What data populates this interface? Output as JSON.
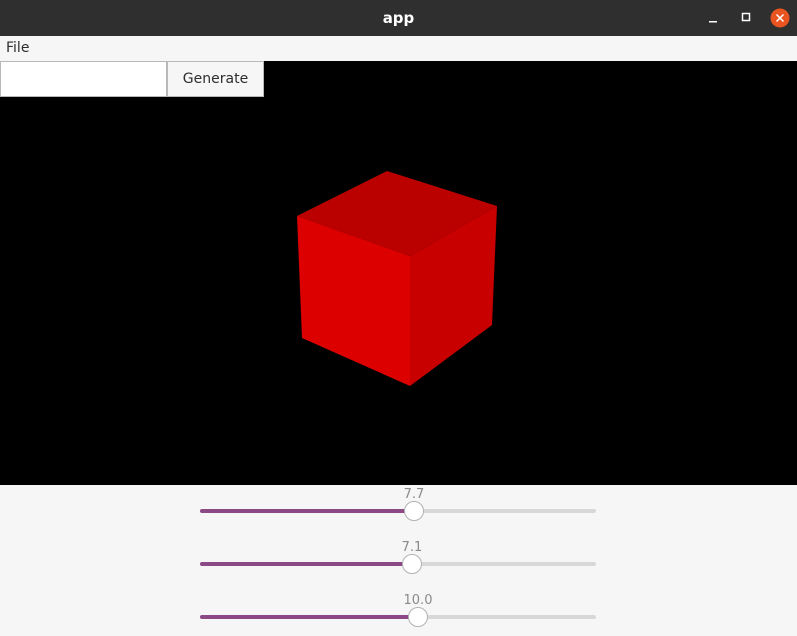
{
  "window": {
    "title": "app"
  },
  "menu": {
    "file_label": "File"
  },
  "toolbar": {
    "input_value": "",
    "generate_label": "Generate"
  },
  "viewport": {
    "object": "cube",
    "face_colors": {
      "front": "#dd0000",
      "top": "#bb0000",
      "right": "#c80000"
    },
    "background": "#000000"
  },
  "sliders": [
    {
      "value_label": "7.7",
      "fraction": 0.54
    },
    {
      "value_label": "7.1",
      "fraction": 0.535
    },
    {
      "value_label": "10.0",
      "fraction": 0.55
    }
  ],
  "accent_color": "#8b4a87"
}
